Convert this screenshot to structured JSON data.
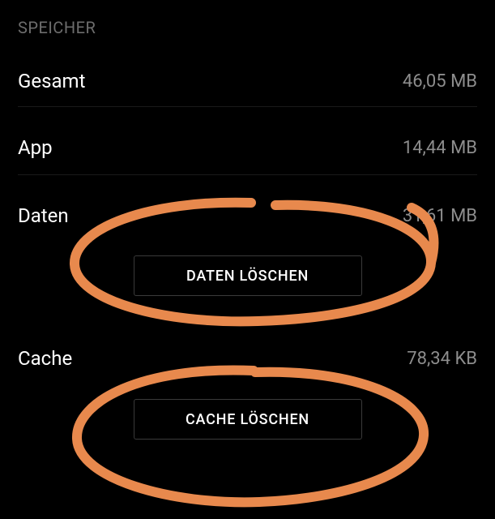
{
  "section": {
    "header": "SPEICHER"
  },
  "rows": {
    "gesamt": {
      "label": "Gesamt",
      "value": "46,05 MB"
    },
    "app": {
      "label": "App",
      "value": "14,44 MB"
    },
    "daten": {
      "label": "Daten",
      "value": "31,61 MB"
    },
    "cache": {
      "label": "Cache",
      "value": "78,34 KB"
    }
  },
  "buttons": {
    "clear_data": "DATEN LÖSCHEN",
    "clear_cache": "CACHE LÖSCHEN"
  },
  "annotation_color": "#e8894d"
}
